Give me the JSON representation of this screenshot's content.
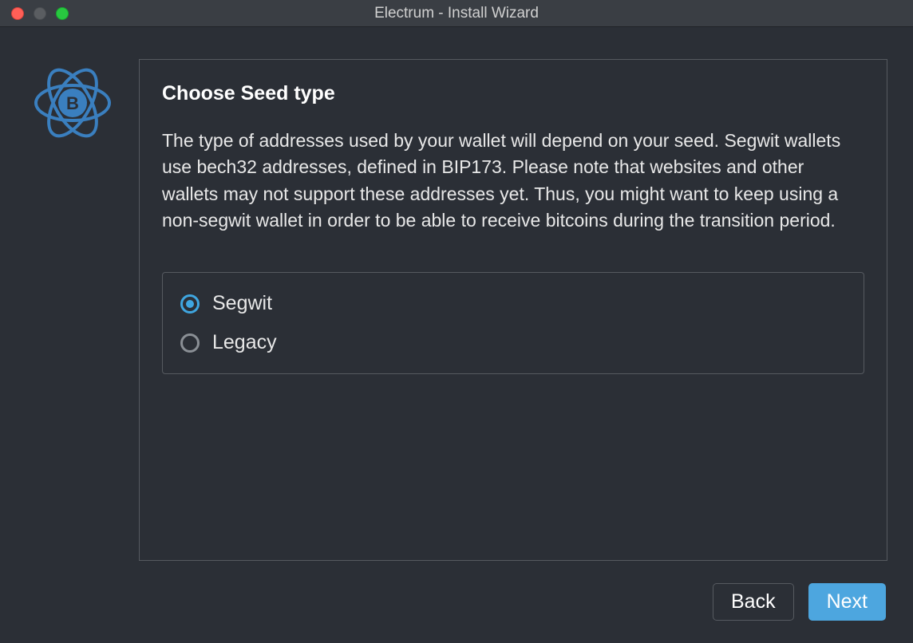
{
  "window": {
    "title": "Electrum  -  Install Wizard"
  },
  "wizard": {
    "heading": "Choose Seed type",
    "description": "The type of addresses used by your wallet will depend on your seed. Segwit wallets use bech32 addresses, defined in BIP173. Please note that websites and other wallets may not support these addresses yet. Thus, you might want to keep using a non-segwit wallet in order to be able to receive bitcoins during the transition period.",
    "options": [
      {
        "label": "Segwit",
        "selected": true
      },
      {
        "label": "Legacy",
        "selected": false
      }
    ],
    "buttons": {
      "back": "Back",
      "next": "Next"
    }
  },
  "colors": {
    "accent": "#4da6df",
    "radio_selected": "#3fa6e0"
  }
}
